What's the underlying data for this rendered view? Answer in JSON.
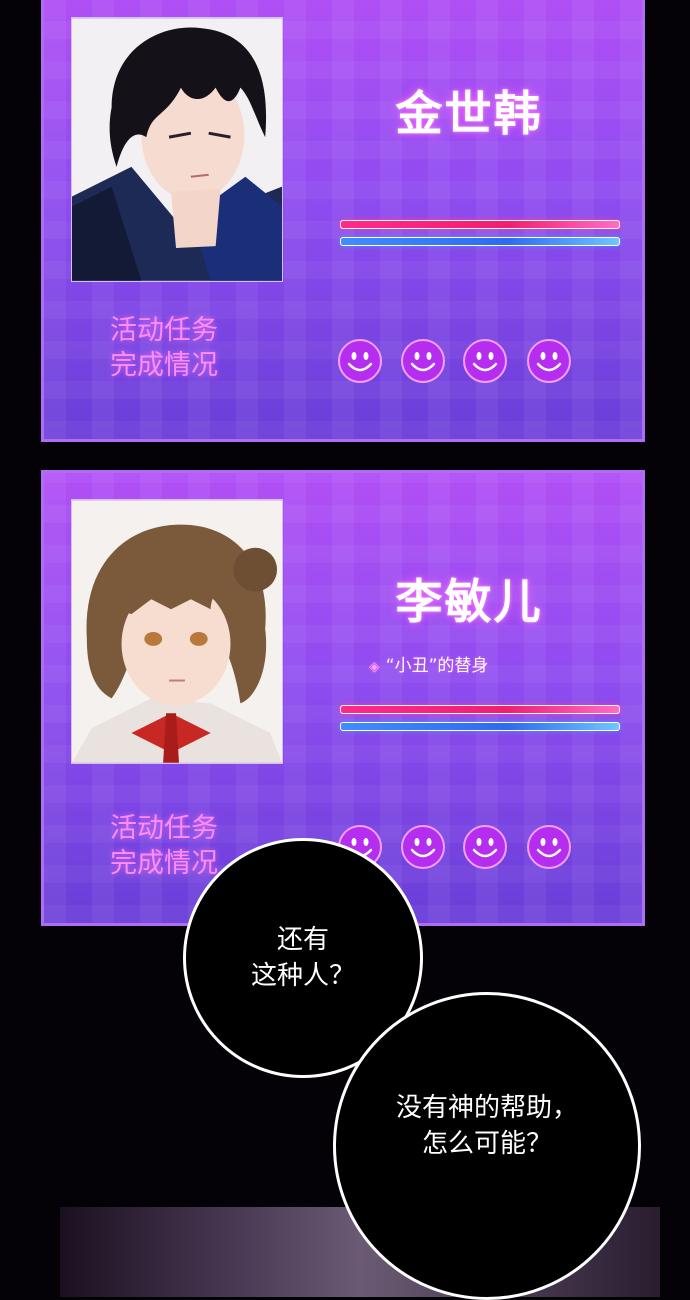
{
  "cards": [
    {
      "name": "金世韩",
      "subtitle": "",
      "task_label_line1": "活动任务",
      "task_label_line2": "完成情况",
      "face_count": 4
    },
    {
      "name": "李敏儿",
      "subtitle_icon": "diamond-icon",
      "subtitle": "“小丑”的替身",
      "task_label_line1": "活动任务",
      "task_label_line2": "完成情况",
      "face_count": 4
    }
  ],
  "bubbles": {
    "first_line1": "还有",
    "first_line2": "这种人？",
    "second_line1": "没有神的帮助，",
    "second_line2": "怎么可能？"
  },
  "colors": {
    "card_gradient_top": "#b14ff5",
    "card_gradient_bottom": "#6a3ed8",
    "hp_bar": "#f0206e",
    "mp_bar": "#2c6cf0",
    "task_label": "#ff8cf4",
    "smiley": "#b52ef0"
  }
}
